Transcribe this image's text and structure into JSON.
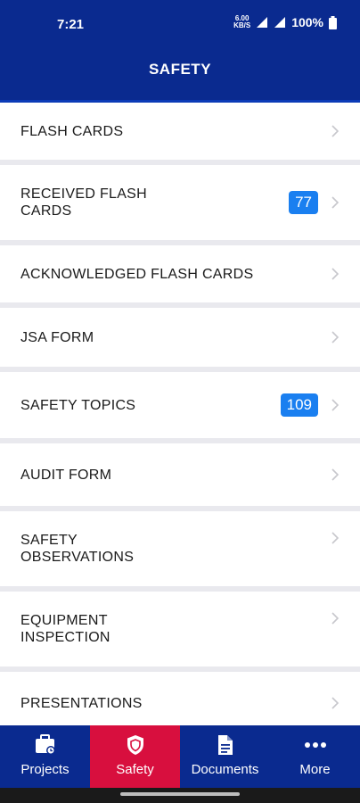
{
  "status": {
    "time": "7:21",
    "network_top": "6.00",
    "network_bottom": "KB/S",
    "battery": "100%"
  },
  "header": {
    "title": "SAFETY"
  },
  "menu": [
    {
      "label": "FLASH CARDS",
      "badge": ""
    },
    {
      "label": "RECEIVED FLASH CARDS",
      "badge": "77"
    },
    {
      "label": "ACKNOWLEDGED FLASH CARDS",
      "badge": ""
    },
    {
      "label": "JSA FORM",
      "badge": ""
    },
    {
      "label": "SAFETY TOPICS",
      "badge": "109"
    },
    {
      "label": "AUDIT FORM",
      "badge": ""
    },
    {
      "label": "SAFETY OBSERVATIONS",
      "badge": ""
    },
    {
      "label": "EQUIPMENT INSPECTION",
      "badge": ""
    },
    {
      "label": "PRESENTATIONS",
      "badge": ""
    }
  ],
  "nav": [
    {
      "label": "Projects",
      "icon": "briefcase-icon"
    },
    {
      "label": "Safety",
      "icon": "shield-icon"
    },
    {
      "label": "Documents",
      "icon": "document-icon"
    },
    {
      "label": "More",
      "icon": "more-dots-icon"
    }
  ],
  "colors": {
    "primary": "#0a2a8f",
    "active": "#d80f3e",
    "badge": "#1a7ff0"
  }
}
